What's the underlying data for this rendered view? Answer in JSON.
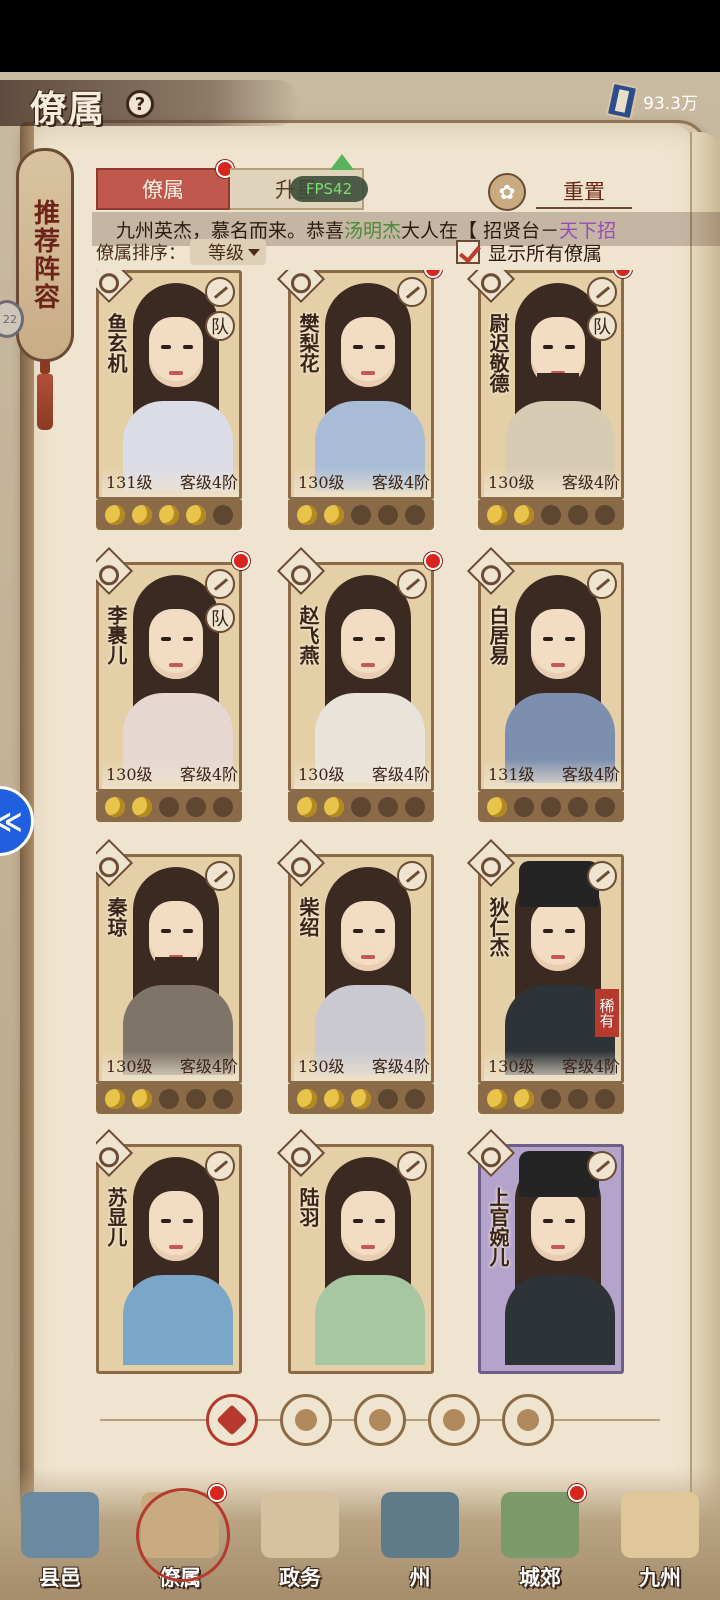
{
  "title_bar": {
    "title": "僚属",
    "help": "?",
    "currency_value": "93.3万"
  },
  "recommend": {
    "label": "推荐阵容"
  },
  "side_badge": "22",
  "floating_ball": "≪",
  "tabs": [
    {
      "label": "僚属"
    },
    {
      "label": "升星"
    }
  ],
  "fps": "FPS42",
  "reset": {
    "label": "重置"
  },
  "marquee": {
    "prefix": "九州英杰，慕名而来。恭喜",
    "name": "汤明杰",
    "middle": "大人在【 招贤台－",
    "place": "天下招"
  },
  "sort": {
    "label": "僚属排序：",
    "value": "等级"
  },
  "show_all": {
    "label": "显示所有僚属",
    "checked": true
  },
  "cards": [
    {
      "name": "鱼玄机",
      "level": "131级",
      "rank": "客级4阶",
      "stars": 4,
      "team": "队",
      "reddot": false,
      "rare": "",
      "purple": false,
      "skin": "f"
    },
    {
      "name": "樊梨花",
      "level": "130级",
      "rank": "客级4阶",
      "stars": 2,
      "team": "",
      "reddot": true,
      "rare": "",
      "purple": false,
      "skin": "f"
    },
    {
      "name": "尉迟敬德",
      "level": "130级",
      "rank": "客级4阶",
      "stars": 2,
      "team": "队",
      "reddot": true,
      "rare": "",
      "purple": false,
      "skin": "m-beard"
    },
    {
      "name": "李裹儿",
      "level": "130级",
      "rank": "客级4阶",
      "stars": 2,
      "team": "队",
      "reddot": true,
      "rare": "",
      "purple": false,
      "skin": "f"
    },
    {
      "name": "赵飞燕",
      "level": "130级",
      "rank": "客级4阶",
      "stars": 2,
      "team": "",
      "reddot": true,
      "rare": "",
      "purple": false,
      "skin": "f"
    },
    {
      "name": "白居易",
      "level": "131级",
      "rank": "客级4阶",
      "stars": 1,
      "team": "",
      "reddot": false,
      "rare": "",
      "purple": false,
      "skin": "m"
    },
    {
      "name": "秦琼",
      "level": "130级",
      "rank": "客级4阶",
      "stars": 2,
      "team": "",
      "reddot": false,
      "rare": "",
      "purple": false,
      "skin": "m-beard"
    },
    {
      "name": "柴绍",
      "level": "130级",
      "rank": "客级4阶",
      "stars": 3,
      "team": "",
      "reddot": false,
      "rare": "",
      "purple": false,
      "skin": "m"
    },
    {
      "name": "狄仁杰",
      "level": "130级",
      "rank": "客级4阶",
      "stars": 2,
      "team": "",
      "reddot": false,
      "rare": "稀有",
      "purple": false,
      "skin": "m-hat"
    },
    {
      "name": "苏显儿",
      "level": "",
      "rank": "",
      "stars": 0,
      "team": "",
      "reddot": false,
      "rare": "",
      "purple": false,
      "skin": "f"
    },
    {
      "name": "陆羽",
      "level": "",
      "rank": "",
      "stars": 0,
      "team": "",
      "reddot": false,
      "rare": "",
      "purple": false,
      "skin": "m"
    },
    {
      "name": "上官婉儿",
      "level": "",
      "rank": "",
      "stars": 0,
      "team": "",
      "reddot": false,
      "rare": "",
      "purple": true,
      "skin": "f-hat"
    }
  ],
  "filters": [
    {
      "name": "all",
      "active": true
    },
    {
      "name": "scholar",
      "active": false
    },
    {
      "name": "merchant",
      "active": false
    },
    {
      "name": "artisan",
      "active": false
    },
    {
      "name": "farmer",
      "active": false
    }
  ],
  "bottom_nav": [
    {
      "label": "县邑",
      "active": false,
      "reddot": false,
      "color": "#6b8aa0"
    },
    {
      "label": "僚属",
      "active": true,
      "reddot": true,
      "color": "#c9ab82"
    },
    {
      "label": "政务",
      "active": false,
      "reddot": false,
      "color": "#d6c2a0"
    },
    {
      "label": "州",
      "active": false,
      "reddot": false,
      "color": "#5f7a88"
    },
    {
      "label": "城郊",
      "active": false,
      "reddot": true,
      "color": "#7a9a6a"
    },
    {
      "label": "九州",
      "active": false,
      "reddot": false,
      "color": "#e0c79a"
    }
  ],
  "colors": {
    "accent_red": "#c0584d",
    "reddot": "#d8261c",
    "paper": "#efe4cf",
    "frame": "#8b6a48"
  }
}
